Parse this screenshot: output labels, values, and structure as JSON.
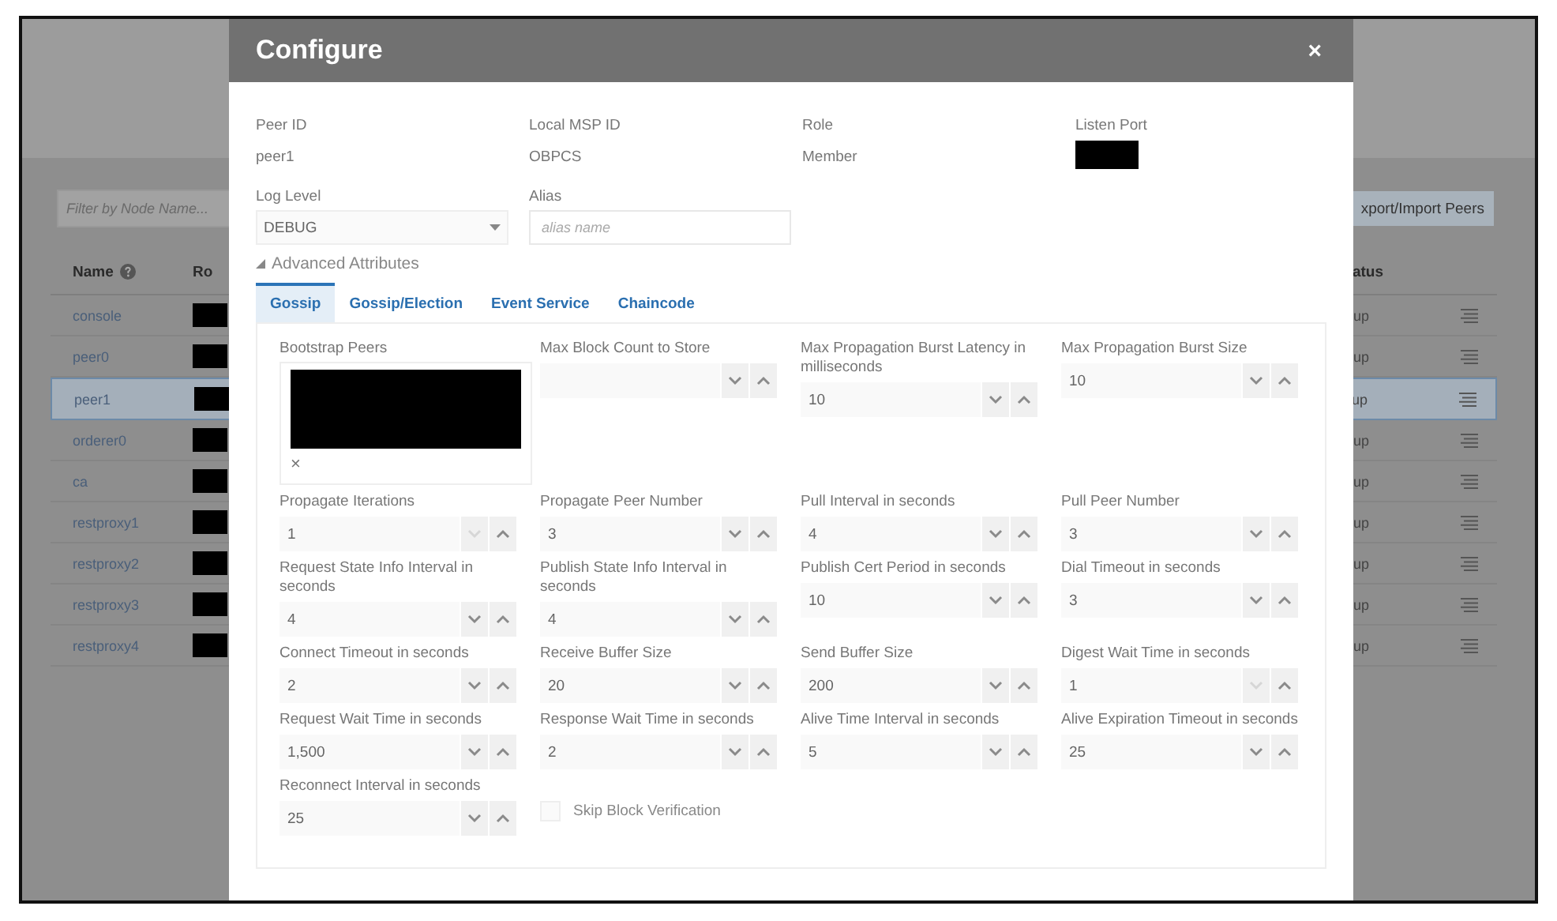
{
  "background": {
    "filter": {
      "placeholder": "Filter by Node Name..."
    },
    "export_button": "xport/Import Peers",
    "columns": [
      {
        "label": "Name",
        "help": true
      },
      {
        "label": "Ro",
        "help": false
      },
      {
        "label": "atus",
        "help": false
      }
    ],
    "rows": [
      {
        "name": "console",
        "role_redacted": true,
        "status": "up",
        "selected": false
      },
      {
        "name": "peer0",
        "role_redacted": true,
        "status": "up",
        "selected": false
      },
      {
        "name": "peer1",
        "role_redacted": true,
        "status": "up",
        "selected": true
      },
      {
        "name": "orderer0",
        "role_redacted": true,
        "status": "up",
        "selected": false
      },
      {
        "name": "ca",
        "role_redacted": true,
        "status": "up",
        "selected": false
      },
      {
        "name": "restproxy1",
        "role_redacted": true,
        "status": "up",
        "selected": false
      },
      {
        "name": "restproxy2",
        "role_redacted": true,
        "status": "up",
        "selected": false
      },
      {
        "name": "restproxy3",
        "role_redacted": true,
        "status": "up",
        "selected": false
      },
      {
        "name": "restproxy4",
        "role_redacted": true,
        "status": "up",
        "selected": false
      }
    ]
  },
  "dialog": {
    "title": "Configure",
    "close": "×",
    "info": [
      {
        "label": "Peer ID",
        "value": "peer1",
        "redacted": false
      },
      {
        "label": "Local MSP ID",
        "value": "OBPCS",
        "redacted": false
      },
      {
        "label": "Role",
        "value": "Member",
        "redacted": false
      },
      {
        "label": "Listen Port",
        "redacted": true
      }
    ],
    "log_level": {
      "label": "Log Level",
      "value": "DEBUG"
    },
    "alias": {
      "label": "Alias",
      "placeholder": "alias name"
    },
    "advanced": {
      "label": "Advanced Attributes",
      "expanded": true
    },
    "tabs": [
      {
        "label": "Gossip",
        "selected": true
      },
      {
        "label": "Gossip/Election",
        "selected": false
      },
      {
        "label": "Event Service",
        "selected": false
      },
      {
        "label": "Chaincode",
        "selected": false
      }
    ],
    "fields": [
      {
        "kind": "tags",
        "label": "Bootstrap Peers",
        "remove": "×"
      },
      {
        "kind": "spinner",
        "label": "Max Block Count to Store",
        "down_disabled": false
      },
      {
        "kind": "spinner",
        "label": "Max Propagation Burst Latency in milliseconds",
        "value": "10",
        "down_disabled": false
      },
      {
        "kind": "spinner",
        "label": "Max Propagation Burst Size",
        "value": "10",
        "down_disabled": false
      },
      {
        "kind": "spinner",
        "label": "Propagate Iterations",
        "value": "1",
        "down_disabled": true
      },
      {
        "kind": "spinner",
        "label": "Propagate Peer Number",
        "value": "3",
        "down_disabled": false
      },
      {
        "kind": "spinner",
        "label": "Pull Interval in seconds",
        "value": "4",
        "down_disabled": false
      },
      {
        "kind": "spinner",
        "label": "Pull Peer Number",
        "value": "3",
        "down_disabled": false
      },
      {
        "kind": "spinner",
        "label": "Request State Info Interval in seconds",
        "value": "4",
        "down_disabled": false
      },
      {
        "kind": "spinner",
        "label": "Publish State Info Interval in seconds",
        "value": "4",
        "down_disabled": false
      },
      {
        "kind": "spinner",
        "label": "Publish Cert Period in seconds",
        "value": "10",
        "down_disabled": false
      },
      {
        "kind": "spinner",
        "label": "Dial Timeout in seconds",
        "value": "3",
        "down_disabled": false
      },
      {
        "kind": "spinner",
        "label": "Connect Timeout in seconds",
        "value": "2",
        "down_disabled": false
      },
      {
        "kind": "spinner",
        "label": "Receive Buffer Size",
        "value": "20",
        "down_disabled": false
      },
      {
        "kind": "spinner",
        "label": "Send Buffer Size",
        "value": "200",
        "down_disabled": false
      },
      {
        "kind": "spinner",
        "label": "Digest Wait Time in seconds",
        "value": "1",
        "down_disabled": true
      },
      {
        "kind": "spinner",
        "label": "Request Wait Time in seconds",
        "value": "1,500",
        "down_disabled": false
      },
      {
        "kind": "spinner",
        "label": "Response Wait Time in seconds",
        "value": "2",
        "down_disabled": false
      },
      {
        "kind": "spinner",
        "label": "Alive Time Interval in seconds",
        "value": "5",
        "down_disabled": false
      },
      {
        "kind": "spinner",
        "label": "Alive Expiration Timeout in seconds",
        "value": "25",
        "down_disabled": false
      },
      {
        "kind": "spinner",
        "label": "Reconnect Interval in seconds",
        "value": "25",
        "down_disabled": false
      },
      {
        "kind": "checkbox",
        "label": "Skip Block Verification",
        "checked": false
      }
    ]
  }
}
